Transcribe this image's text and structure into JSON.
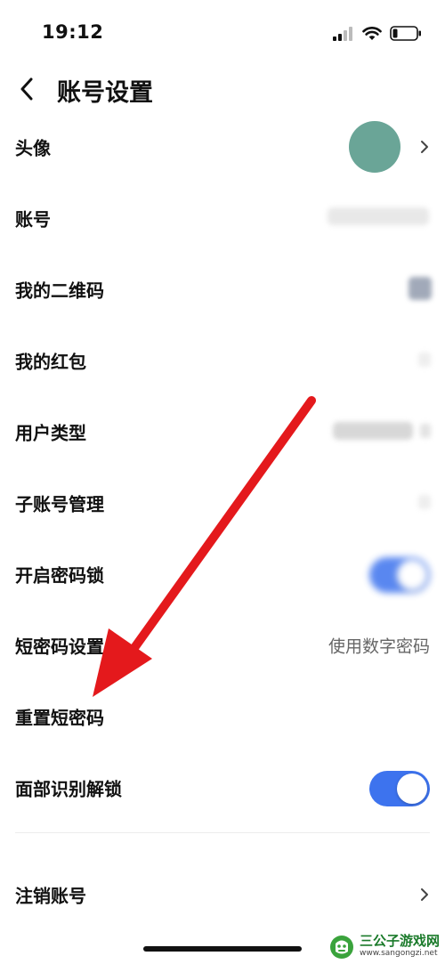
{
  "status_bar": {
    "time": "19:12",
    "icons": [
      "signal-icon",
      "wifi-icon",
      "battery-icon"
    ]
  },
  "nav": {
    "back_icon": "chevron-left-icon",
    "title": "账号设置"
  },
  "rows": {
    "avatar": {
      "label": "头像"
    },
    "account": {
      "label": "账号"
    },
    "qrcode": {
      "label": "我的二维码"
    },
    "red_packet": {
      "label": "我的红包"
    },
    "user_type": {
      "label": "用户类型"
    },
    "sub_account": {
      "label": "子账号管理"
    },
    "password_lock": {
      "label": "开启密码锁",
      "enabled": true
    },
    "short_password": {
      "label": "短密码设置",
      "value": "使用数字密码"
    },
    "reset_short_password": {
      "label": "重置短密码"
    },
    "face_unlock": {
      "label": "面部识别解锁",
      "enabled": true
    },
    "cancel_account": {
      "label": "注销账号"
    }
  },
  "colors": {
    "toggle_on": "#3d73ee",
    "avatar": "#6aa597",
    "annotation_arrow": "#e4191c"
  },
  "watermark": {
    "name": "三公子游戏网",
    "url": "www.sangongzi.net"
  }
}
